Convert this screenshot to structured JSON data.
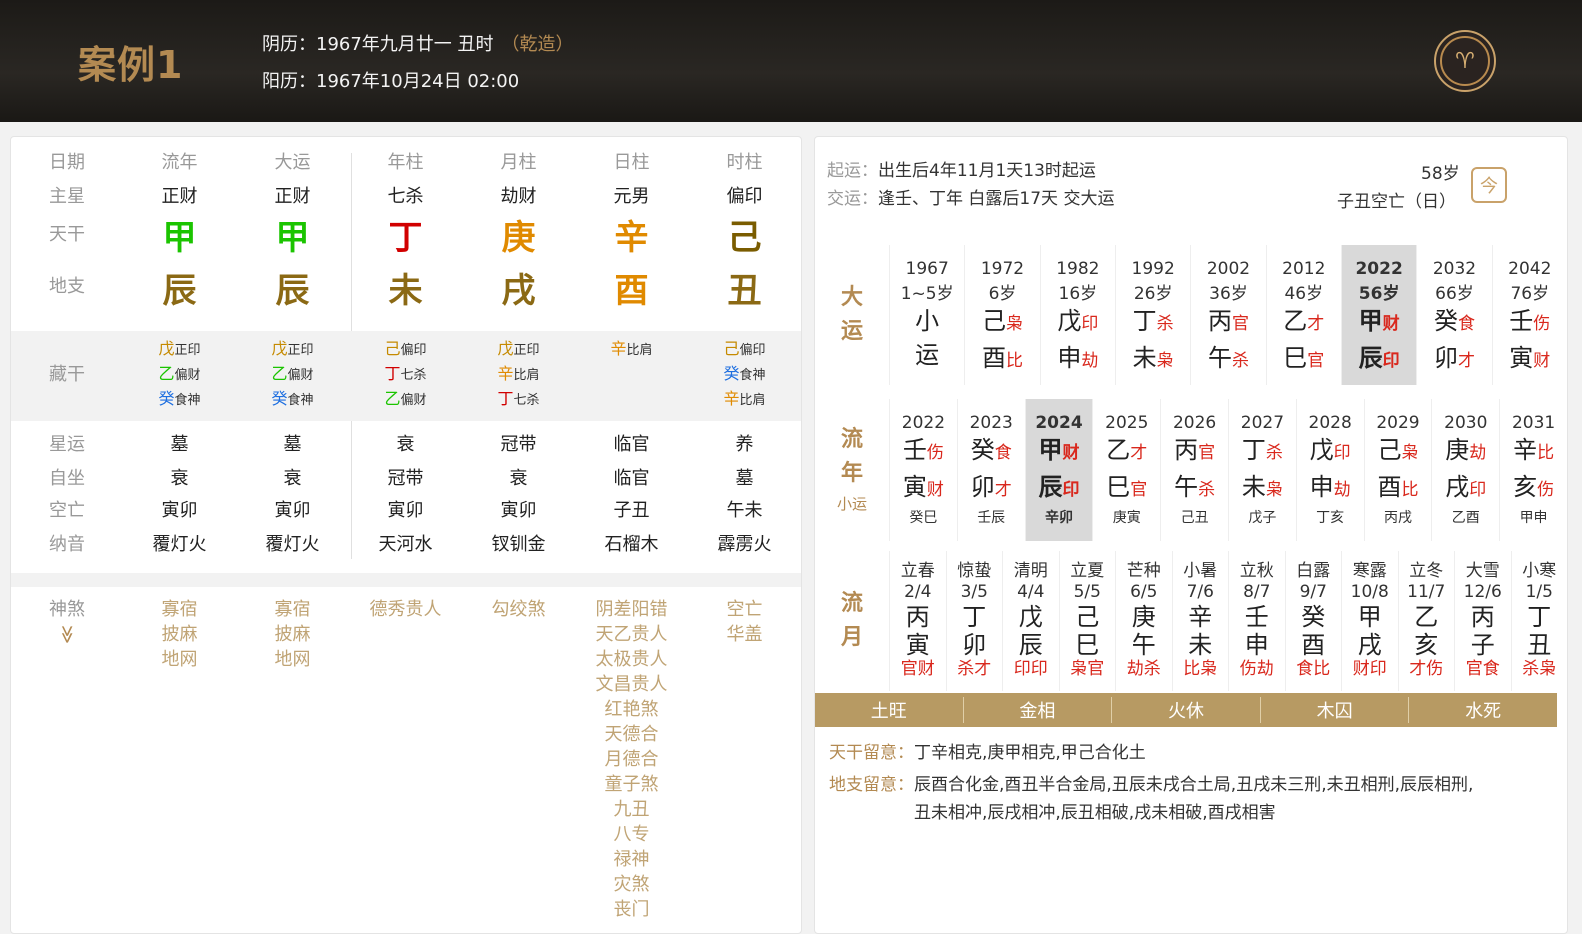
{
  "header": {
    "case_title": "案例1",
    "lunar": "阴历：1967年九月廿一 丑时",
    "qianzao": "（乾造）",
    "solar": "阳历：1967年10月24日 02:00"
  },
  "left": {
    "head": {
      "label": "日期",
      "cols": [
        "流年",
        "大运",
        "年柱",
        "月柱",
        "日柱",
        "时柱"
      ]
    },
    "zhuxing": {
      "label": "主星",
      "cols": [
        "正财",
        "正财",
        "七杀",
        "劫财",
        "元男",
        "偏印"
      ]
    },
    "tiangan": {
      "label": "天干",
      "cols": [
        "甲",
        "甲",
        "丁",
        "庚",
        "辛",
        "己"
      ],
      "colors": [
        "#1bc400",
        "#1bc400",
        "#d10000",
        "#e08a00",
        "#e08a00",
        "#7a5c00"
      ]
    },
    "dizhi": {
      "label": "地支",
      "cols": [
        "辰",
        "辰",
        "未",
        "戌",
        "酉",
        "丑"
      ],
      "colors": [
        "#8b6914",
        "#8b6914",
        "#8b6914",
        "#8b6914",
        "#e08a00",
        "#8b6914"
      ]
    },
    "canggan": {
      "label": "藏干",
      "cols": [
        [
          {
            "g": "戊",
            "s": "正印",
            "c": "#c58a00"
          },
          {
            "g": "乙",
            "s": "偏财",
            "c": "#1bc400"
          },
          {
            "g": "癸",
            "s": "食神",
            "c": "#1e6fe0"
          }
        ],
        [
          {
            "g": "戊",
            "s": "正印",
            "c": "#c58a00"
          },
          {
            "g": "乙",
            "s": "偏财",
            "c": "#1bc400"
          },
          {
            "g": "癸",
            "s": "食神",
            "c": "#1e6fe0"
          }
        ],
        [
          {
            "g": "己",
            "s": "偏印",
            "c": "#c58a00"
          },
          {
            "g": "丁",
            "s": "七杀",
            "c": "#d10000"
          },
          {
            "g": "乙",
            "s": "偏财",
            "c": "#1bc400"
          }
        ],
        [
          {
            "g": "戊",
            "s": "正印",
            "c": "#c58a00"
          },
          {
            "g": "辛",
            "s": "比肩",
            "c": "#e08a00"
          },
          {
            "g": "丁",
            "s": "七杀",
            "c": "#d10000"
          }
        ],
        [
          {
            "g": "辛",
            "s": "比肩",
            "c": "#e08a00"
          }
        ],
        [
          {
            "g": "己",
            "s": "偏印",
            "c": "#c58a00"
          },
          {
            "g": "癸",
            "s": "食神",
            "c": "#1e6fe0"
          },
          {
            "g": "辛",
            "s": "比肩",
            "c": "#e08a00"
          }
        ]
      ]
    },
    "xingyun": {
      "label": "星运",
      "cols": [
        "墓",
        "墓",
        "衰",
        "冠带",
        "临官",
        "养"
      ]
    },
    "zizuo": {
      "label": "自坐",
      "cols": [
        "衰",
        "衰",
        "冠带",
        "衰",
        "临官",
        "墓"
      ]
    },
    "kongwang": {
      "label": "空亡",
      "cols": [
        "寅卯",
        "寅卯",
        "寅卯",
        "寅卯",
        "子丑",
        "午未"
      ]
    },
    "nayin": {
      "label": "纳音",
      "cols": [
        "覆灯火",
        "覆灯火",
        "天河水",
        "钗钏金",
        "石榴木",
        "霹雳火"
      ]
    },
    "shensha": {
      "label": "神煞",
      "toggle": "≫",
      "cols": [
        [
          "寡宿",
          "披麻",
          "地网"
        ],
        [
          "寡宿",
          "披麻",
          "地网"
        ],
        [
          "德秀贵人"
        ],
        [
          "勾绞煞"
        ],
        [
          "阴差阳错",
          "天乙贵人",
          "太极贵人",
          "文昌贵人",
          "红艳煞",
          "天德合",
          "月德合",
          "童子煞",
          "九丑",
          "八专",
          "禄神",
          "灾煞",
          "丧门"
        ],
        [
          "空亡",
          "华盖"
        ]
      ]
    }
  },
  "right": {
    "qiyun_key": "起运：",
    "qiyun_val": "出生后4年11月1天13时起运",
    "jiaoyun_key": "交运：",
    "jiaoyun_val": "逢壬、丁年 白露后17天 交大运",
    "age": "58岁",
    "kongwang": "子丑空亡（日）",
    "cal_icon": "今",
    "dayun": {
      "side": [
        "大",
        "运"
      ],
      "items": [
        {
          "y": "1967",
          "a": "1~5岁",
          "g": "小",
          "gs": "",
          "z": "运",
          "zs": ""
        },
        {
          "y": "1972",
          "a": "6岁",
          "g": "己",
          "gs": "枭",
          "z": "酉",
          "zs": "比"
        },
        {
          "y": "1982",
          "a": "16岁",
          "g": "戊",
          "gs": "印",
          "z": "申",
          "zs": "劫"
        },
        {
          "y": "1992",
          "a": "26岁",
          "g": "丁",
          "gs": "杀",
          "z": "未",
          "zs": "枭"
        },
        {
          "y": "2002",
          "a": "36岁",
          "g": "丙",
          "gs": "官",
          "z": "午",
          "zs": "杀"
        },
        {
          "y": "2012",
          "a": "46岁",
          "g": "乙",
          "gs": "才",
          "z": "巳",
          "zs": "官"
        },
        {
          "y": "2022",
          "a": "56岁",
          "g": "甲",
          "gs": "财",
          "z": "辰",
          "zs": "印",
          "active": true
        },
        {
          "y": "2032",
          "a": "66岁",
          "g": "癸",
          "gs": "食",
          "z": "卯",
          "zs": "才"
        },
        {
          "y": "2042",
          "a": "76岁",
          "g": "壬",
          "gs": "伤",
          "z": "寅",
          "zs": "财"
        }
      ]
    },
    "liunian": {
      "side": [
        "流",
        "年"
      ],
      "sub": "小运",
      "items": [
        {
          "y": "2022",
          "g": "壬",
          "gs": "伤",
          "z": "寅",
          "zs": "财",
          "x": "癸巳"
        },
        {
          "y": "2023",
          "g": "癸",
          "gs": "食",
          "z": "卯",
          "zs": "才",
          "x": "壬辰"
        },
        {
          "y": "2024",
          "g": "甲",
          "gs": "财",
          "z": "辰",
          "zs": "印",
          "x": "辛卯",
          "active": true
        },
        {
          "y": "2025",
          "g": "乙",
          "gs": "才",
          "z": "巳",
          "zs": "官",
          "x": "庚寅"
        },
        {
          "y": "2026",
          "g": "丙",
          "gs": "官",
          "z": "午",
          "zs": "杀",
          "x": "己丑"
        },
        {
          "y": "2027",
          "g": "丁",
          "gs": "杀",
          "z": "未",
          "zs": "枭",
          "x": "戊子"
        },
        {
          "y": "2028",
          "g": "戊",
          "gs": "印",
          "z": "申",
          "zs": "劫",
          "x": "丁亥"
        },
        {
          "y": "2029",
          "g": "己",
          "gs": "枭",
          "z": "酉",
          "zs": "比",
          "x": "丙戌"
        },
        {
          "y": "2030",
          "g": "庚",
          "gs": "劫",
          "z": "戌",
          "zs": "印",
          "x": "乙酉"
        },
        {
          "y": "2031",
          "g": "辛",
          "gs": "比",
          "z": "亥",
          "zs": "伤",
          "x": "甲申"
        }
      ]
    },
    "liuyue": {
      "side": [
        "流",
        "月"
      ],
      "items": [
        {
          "j": "立春",
          "d": "2/4",
          "g": "丙",
          "z": "寅",
          "s": "官财"
        },
        {
          "j": "惊蛰",
          "d": "3/5",
          "g": "丁",
          "z": "卯",
          "s": "杀才"
        },
        {
          "j": "清明",
          "d": "4/4",
          "g": "戊",
          "z": "辰",
          "s": "印印"
        },
        {
          "j": "立夏",
          "d": "5/5",
          "g": "己",
          "z": "巳",
          "s": "枭官"
        },
        {
          "j": "芒种",
          "d": "6/5",
          "g": "庚",
          "z": "午",
          "s": "劫杀"
        },
        {
          "j": "小暑",
          "d": "7/6",
          "g": "辛",
          "z": "未",
          "s": "比枭"
        },
        {
          "j": "立秋",
          "d": "8/7",
          "g": "壬",
          "z": "申",
          "s": "伤劫"
        },
        {
          "j": "白露",
          "d": "9/7",
          "g": "癸",
          "z": "酉",
          "s": "食比"
        },
        {
          "j": "寒露",
          "d": "10/8",
          "g": "甲",
          "z": "戌",
          "s": "财印"
        },
        {
          "j": "立冬",
          "d": "11/7",
          "g": "乙",
          "z": "亥",
          "s": "才伤"
        },
        {
          "j": "大雪",
          "d": "12/6",
          "g": "丙",
          "z": "子",
          "s": "官食"
        },
        {
          "j": "小寒",
          "d": "1/5",
          "g": "丁",
          "z": "丑",
          "s": "杀枭"
        }
      ]
    },
    "wuxing": [
      "土旺",
      "金相",
      "火休",
      "木囚",
      "水死"
    ],
    "tiangan_note_key": "天干留意：",
    "tiangan_note": "丁辛相克,庚甲相克,甲己合化土",
    "dizhi_note_key": "地支留意：",
    "dizhi_note_1": "辰酉合化金,酉丑半合金局,丑辰未戌合土局,丑戌未三刑,未丑相刑,辰辰相刑,",
    "dizhi_note_2": "丑未相冲,辰戌相冲,辰丑相破,戌未相破,酉戌相害"
  }
}
